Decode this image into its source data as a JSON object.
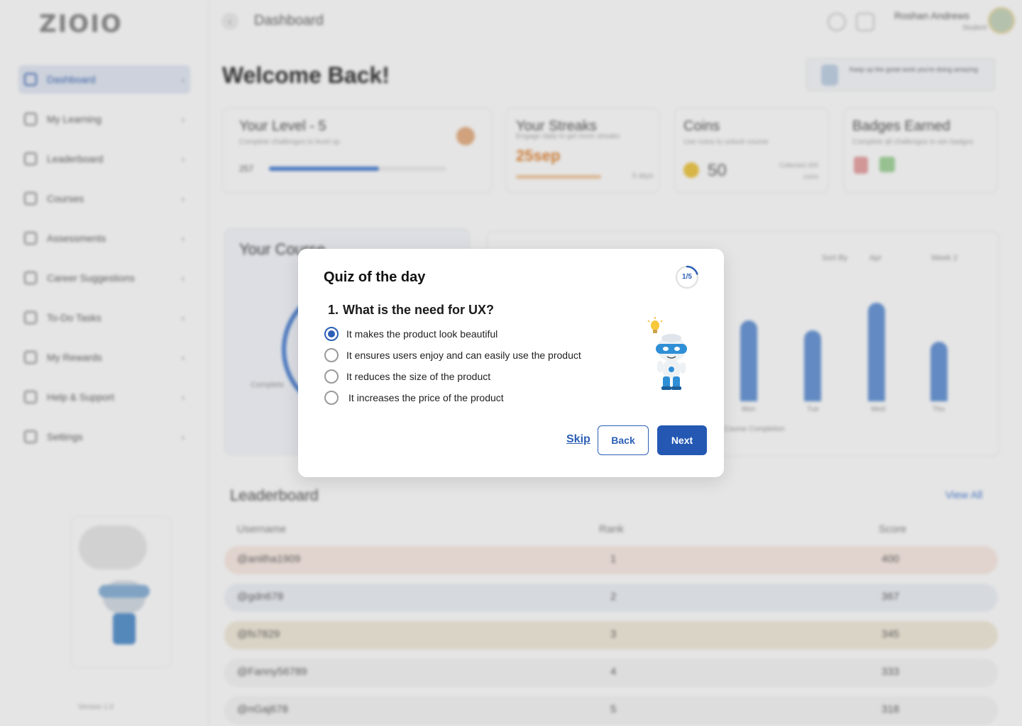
{
  "app": {
    "logo": "ZIOIO",
    "logo_sub": ""
  },
  "topbar": {
    "title": "Dashboard",
    "user_name": "Roshan Andrews",
    "user_role": "Student"
  },
  "sidebar": {
    "items": [
      {
        "label": "Dashboard",
        "active": true
      },
      {
        "label": "My Learning"
      },
      {
        "label": "Leaderboard"
      },
      {
        "label": "Courses"
      },
      {
        "label": "Assessments"
      },
      {
        "label": "Career Suggestions"
      },
      {
        "label": "To-Do Tasks"
      },
      {
        "label": "My Rewards"
      },
      {
        "label": "Help & Support"
      },
      {
        "label": "Settings"
      }
    ],
    "version": "Version 1.0"
  },
  "dashboard": {
    "welcome": "Welcome Back!",
    "tip": "Keep up the great work you're doing amazing",
    "level": {
      "title": "Your Level - 5",
      "subtitle": "Complete challenges to level up",
      "from": "257",
      "progress": 0.62
    },
    "streaks": {
      "title": "Your Streaks",
      "subtitle": "Engage daily to get more streaks",
      "value": "25sep",
      "days": "5 days"
    },
    "coins": {
      "title": "Coins",
      "subtitle": "Use coins to unlock course",
      "value": "50",
      "note": "Collected 300 coins"
    },
    "badges": {
      "title": "Badges Earned",
      "subtitle": "Complete all challenges to win badges"
    },
    "course_panel": {
      "title": "Your Course",
      "label": "Complete"
    },
    "chart_filters": [
      "Sort By",
      "Apr",
      "Week 2"
    ],
    "chart_caption": "Course Completion",
    "bar_labels": [
      "Mon",
      "Tue",
      "Wed",
      "Thu"
    ],
    "leaderboard": {
      "title": "Leaderboard",
      "view_all": "View All",
      "columns": [
        "Username",
        "Rank",
        "Score"
      ],
      "rows": [
        {
          "user": "@anitha1909",
          "rank": "1",
          "score": "400"
        },
        {
          "user": "@gdn678",
          "rank": "2",
          "score": "367"
        },
        {
          "user": "@fs7829",
          "rank": "3",
          "score": "345"
        },
        {
          "user": "@Fanny56789",
          "rank": "4",
          "score": "333"
        },
        {
          "user": "@nGaj678",
          "rank": "5",
          "score": "318"
        }
      ]
    }
  },
  "quiz": {
    "title": "Quiz of the day",
    "progress_label": "1/5",
    "progress_fraction": 0.2,
    "question_number": "1.",
    "question": "What is the need for UX?",
    "options": [
      {
        "label": "It makes the product look beautiful",
        "selected": true
      },
      {
        "label": "It ensures users enjoy and can easily use the product",
        "selected": false
      },
      {
        "label": "It reduces the size of the product",
        "selected": false
      },
      {
        "label": "It increases the price of the product",
        "selected": false
      }
    ],
    "skip_label": "Skip",
    "back_label": "Back",
    "next_label": "Next",
    "colors": {
      "primary": "#2458b3",
      "accent": "#2c5fb5"
    }
  }
}
